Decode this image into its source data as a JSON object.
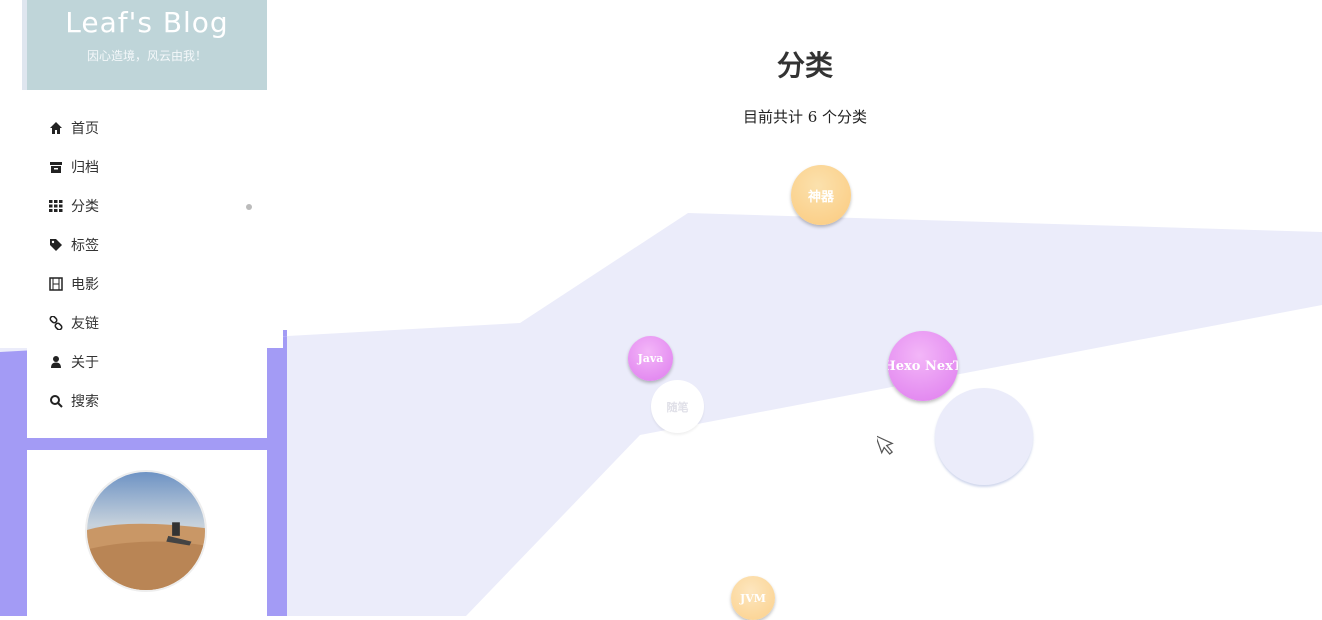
{
  "site": {
    "title": "Leaf's Blog",
    "subtitle": "因心造境，风云由我！"
  },
  "menu": [
    {
      "label": "首页",
      "icon": "home-icon"
    },
    {
      "label": "归档",
      "icon": "archive-icon"
    },
    {
      "label": "分类",
      "icon": "th-icon",
      "active": true
    },
    {
      "label": "标签",
      "icon": "tags-icon"
    },
    {
      "label": "电影",
      "icon": "film-icon"
    },
    {
      "label": "友链",
      "icon": "link-icon"
    },
    {
      "label": "关于",
      "icon": "user-icon"
    },
    {
      "label": "搜索",
      "icon": "search-icon"
    }
  ],
  "main": {
    "title": "分类",
    "count_text": "目前共计 6 个分类"
  },
  "categories": [
    {
      "label": "神器",
      "color": "#fbd08a"
    },
    {
      "label": "Java",
      "color": "#e58af2"
    },
    {
      "label": "Hexo NexT",
      "color": "#e58af2"
    },
    {
      "label": "随笔",
      "color": "#ffffff"
    },
    {
      "label": "",
      "color": "#ebecfa"
    },
    {
      "label": "JVM",
      "color": "#fbd08a"
    }
  ],
  "colors": {
    "band": "#ebecfa",
    "sidebar_bg": "#a39bf5",
    "brand_bg": "#bfd5d9"
  }
}
